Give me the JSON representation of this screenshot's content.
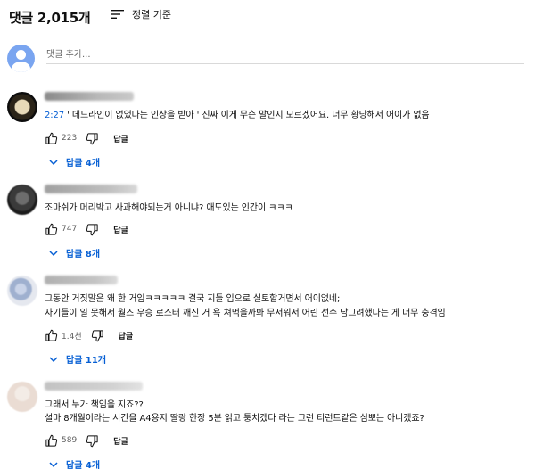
{
  "header": {
    "comment_count": "댓글 2,015개",
    "sort_label": "정렬 기준"
  },
  "add_comment": {
    "placeholder": "댓글 추가..."
  },
  "comments": [
    {
      "timestamp": "2:27",
      "text": "' 데드라인이 없었다는 인상을 받아 ' 진짜 이게 무슨 말인지 모르겠어요. 너무 황당해서 어이가 없음",
      "likes": "223",
      "reply_label": "답글",
      "replies_label": "답글 4개"
    },
    {
      "text": "조마쉬가 머리박고 사과해야되는거 아니냐? 애도있는 인간이 ㅋㅋㅋ",
      "likes": "747",
      "reply_label": "답글",
      "replies_label": "답글 8개"
    },
    {
      "line1": "그동안 거짓말은 왜 한 거임ㅋㅋㅋㅋㅋ 결국 지들 입으로 실토할거면서 어이없네;",
      "line2": "자기들이 일 못해서 월즈 우승 로스터 깨진 거 욕 쳐먹을까봐 무서워서 어린 선수 담그려했다는 게 너무 충격임",
      "likes": "1.4천",
      "reply_label": "답글",
      "replies_label": "답글 11개"
    },
    {
      "line1": "그래서 누가 책임을 지죠??",
      "line2": "설마 8개월이라는 시간을 A4용지 딸랑 한장 5분 읽고 퉁치겠다 라는 그런 티런트같은 심뽀는 아니겠죠?",
      "likes": "589",
      "reply_label": "답글",
      "replies_label": "답글 4개"
    }
  ],
  "colors": {
    "link": "#065fd4",
    "text": "#0f0f0f",
    "secondary": "#606060",
    "avatar_self": "#7aa5f0"
  },
  "icons": {
    "sort": "sort-lines-icon",
    "like": "thumb-up-icon",
    "dislike": "thumb-down-icon",
    "expand": "chevron-down-icon"
  }
}
